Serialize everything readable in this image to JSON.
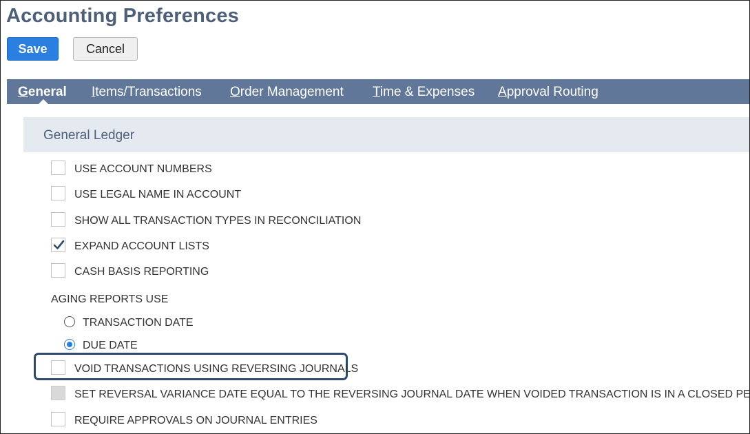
{
  "page": {
    "title": "Accounting Preferences"
  },
  "toolbar": {
    "save_label": "Save",
    "cancel_label": "Cancel"
  },
  "tabs": [
    {
      "first": "G",
      "rest": "eneral",
      "active": true
    },
    {
      "first": "I",
      "rest": "tems/Transactions",
      "active": false
    },
    {
      "first": "O",
      "rest": "rder Management",
      "active": false
    },
    {
      "first": "T",
      "rest": "ime & Expenses",
      "active": false
    },
    {
      "first": "A",
      "rest": "pproval Routing",
      "active": false
    }
  ],
  "section": {
    "title": "General Ledger"
  },
  "options": [
    {
      "label": "USE ACCOUNT NUMBERS",
      "checked": false,
      "disabled": false
    },
    {
      "label": "USE LEGAL NAME IN ACCOUNT",
      "checked": false,
      "disabled": false
    },
    {
      "label": "SHOW ALL TRANSACTION TYPES IN RECONCILIATION",
      "checked": false,
      "disabled": false
    },
    {
      "label": "EXPAND ACCOUNT LISTS",
      "checked": true,
      "disabled": false
    },
    {
      "label": "CASH BASIS REPORTING",
      "checked": false,
      "disabled": false
    }
  ],
  "aging": {
    "label": "AGING REPORTS USE",
    "choices": [
      {
        "label": "TRANSACTION DATE",
        "selected": false
      },
      {
        "label": "DUE DATE",
        "selected": true
      }
    ]
  },
  "options_after": [
    {
      "label": "VOID TRANSACTIONS USING REVERSING JOURNALS",
      "checked": false,
      "disabled": false,
      "highlighted": true
    },
    {
      "label": "SET REVERSAL VARIANCE DATE EQUAL TO THE REVERSING JOURNAL DATE WHEN VOIDED TRANSACTION IS IN A CLOSED PERIOD",
      "checked": false,
      "disabled": true,
      "highlighted": false
    },
    {
      "label": "REQUIRE APPROVALS ON JOURNAL ENTRIES",
      "checked": false,
      "disabled": false,
      "highlighted": false
    }
  ],
  "colors": {
    "accent": "#2a7fe0",
    "tabbar": "#607799",
    "heading": "#4d5f79",
    "section_bg": "#e5e9f0"
  }
}
